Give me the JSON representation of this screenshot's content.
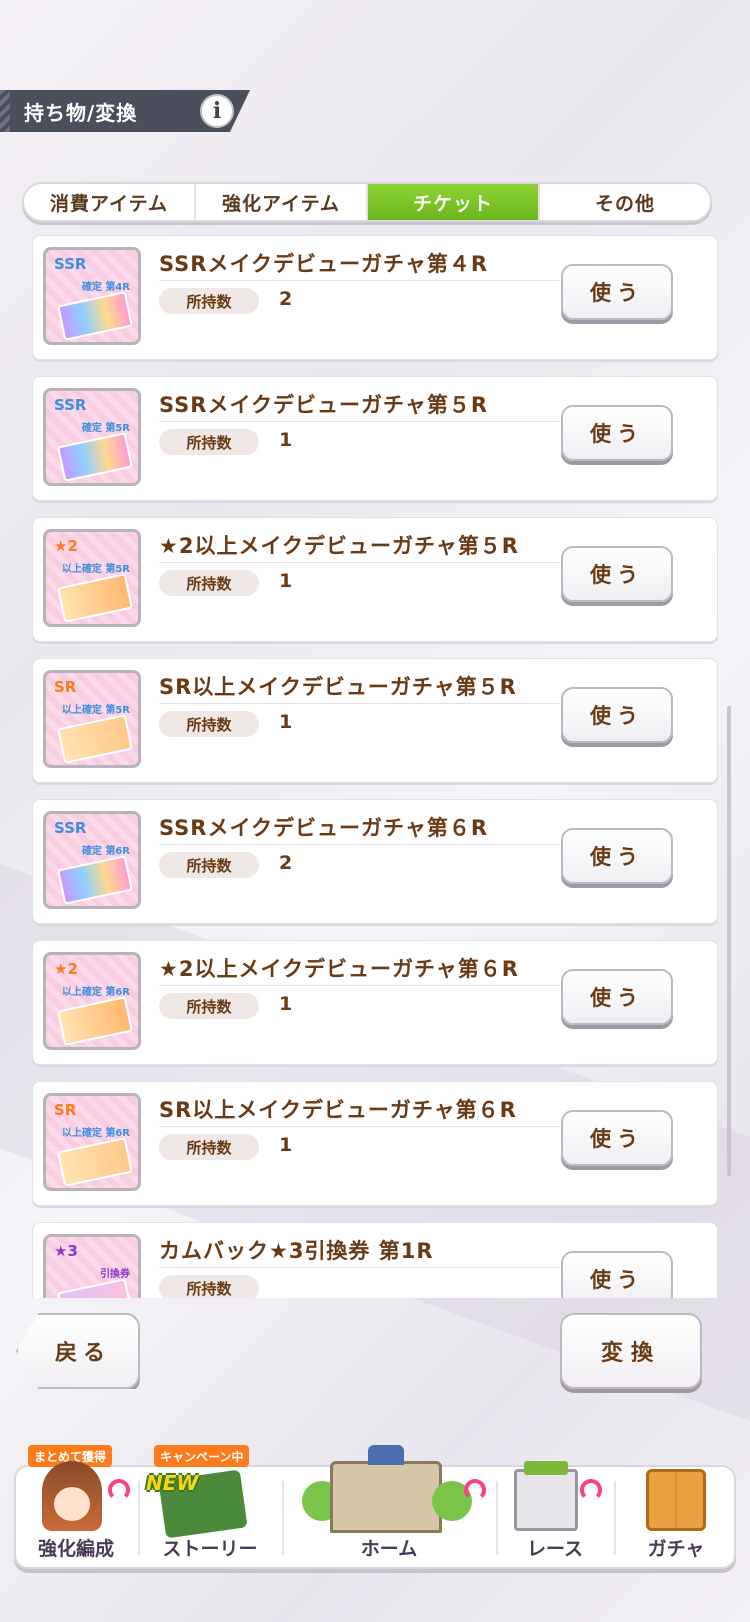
{
  "header": {
    "title": "持ち物/変換",
    "info_icon": "info-icon"
  },
  "tabs": [
    {
      "label": "消費アイテム",
      "active": false
    },
    {
      "label": "強化アイテム",
      "active": false
    },
    {
      "label": "チケット",
      "active": true
    },
    {
      "label": "その他",
      "active": false
    }
  ],
  "qty_label": "所持数",
  "use_label": "使う",
  "items": [
    {
      "title": "SSRメイクデビューガチャ第４R",
      "qty": "2",
      "thumb_label": "SSR",
      "thumb_sub": "確定 第4R"
    },
    {
      "title": "SSRメイクデビューガチャ第５R",
      "qty": "1",
      "thumb_label": "SSR",
      "thumb_sub": "確定 第5R"
    },
    {
      "title": "★2以上メイクデビューガチャ第５R",
      "qty": "1",
      "thumb_label": "★2",
      "thumb_sub": "以上確定 第5R"
    },
    {
      "title": "SR以上メイクデビューガチャ第５R",
      "qty": "1",
      "thumb_label": "SR",
      "thumb_sub": "以上確定 第5R"
    },
    {
      "title": "SSRメイクデビューガチャ第６R",
      "qty": "2",
      "thumb_label": "SSR",
      "thumb_sub": "確定 第6R"
    },
    {
      "title": "★2以上メイクデビューガチャ第６R",
      "qty": "1",
      "thumb_label": "★2",
      "thumb_sub": "以上確定 第6R"
    },
    {
      "title": "SR以上メイクデビューガチャ第６R",
      "qty": "1",
      "thumb_label": "SR",
      "thumb_sub": "以上確定 第6R"
    },
    {
      "title": "カムバック★3引換券 第1R",
      "qty": "",
      "thumb_label": "★3",
      "thumb_sub": "引換券"
    }
  ],
  "actions": {
    "back_label": "戻る",
    "convert_label": "変換"
  },
  "nav": [
    {
      "label": "強化編成",
      "badge": "まとめて獲得"
    },
    {
      "label": "ストーリー",
      "badge": "キャンペーン中",
      "new_tag": "NEW"
    },
    {
      "label": "ホーム",
      "badge": ""
    },
    {
      "label": "レース",
      "badge": ""
    },
    {
      "label": "ガチャ",
      "badge": ""
    }
  ],
  "colors": {
    "accent_green": "#7ac424",
    "text_brown": "#6a3a14",
    "header_dark": "#4b4f5c",
    "badge_orange": "#ff7a1a"
  }
}
